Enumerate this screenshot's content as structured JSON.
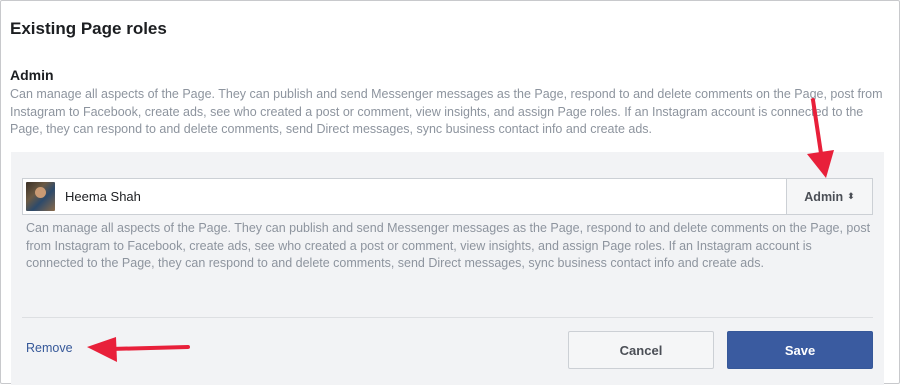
{
  "section": {
    "title": "Existing Page roles"
  },
  "role": {
    "heading": "Admin",
    "description": "Can manage all aspects of the Page. They can publish and send Messenger messages as the Page, respond to and delete comments on the Page, post from Instagram to Facebook, create ads, see who created a post or comment, view insights, and assign Page roles. If an Instagram account is connected to the Page, they can respond to and delete comments, send Direct messages, sync business contact info and create ads."
  },
  "member": {
    "name": "Heema Shah",
    "role_selected": "Admin",
    "role_caret": "⬍",
    "description": "Can manage all aspects of the Page. They can publish and send Messenger messages as the Page, respond to and delete comments on the Page, post from Instagram to Facebook, create ads, see who created a post or comment, view insights, and assign Page roles. If an Instagram account is connected to the Page, they can respond to and delete comments, send Direct messages, sync business contact info and create ads."
  },
  "actions": {
    "remove_label": "Remove",
    "cancel_label": "Cancel",
    "save_label": "Save"
  },
  "colors": {
    "save_button": "#3a5ba0",
    "link": "#365899",
    "annotation_arrow": "#e8203a"
  }
}
